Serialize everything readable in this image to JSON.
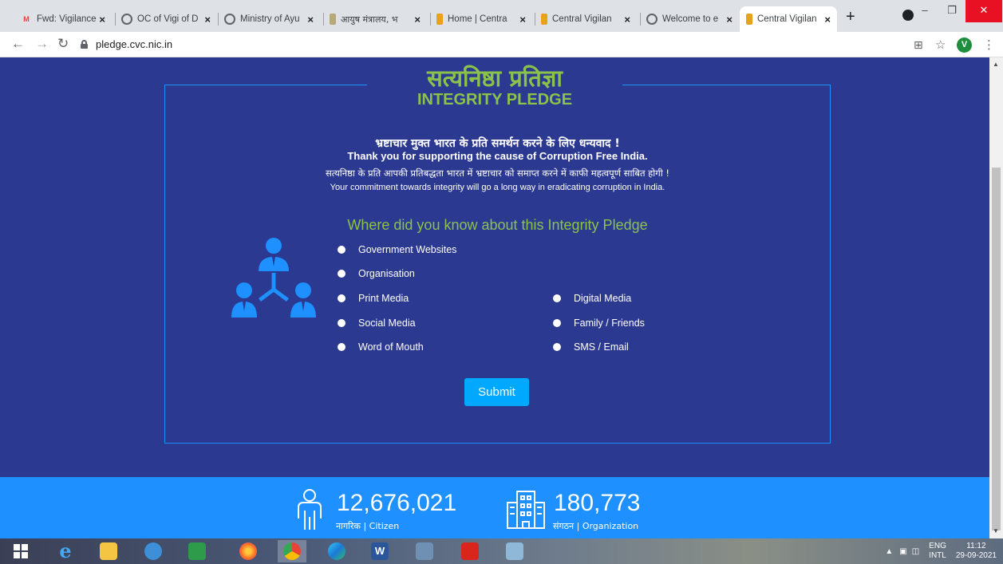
{
  "browser": {
    "tabs": [
      {
        "title": "Fwd: Vigilance",
        "icon": "gmail-icon",
        "color": "#ea4335"
      },
      {
        "title": "OC of Vigi of D",
        "icon": "globe-icon",
        "color": "#5f6368"
      },
      {
        "title": "Ministry of Ayu",
        "icon": "globe-icon",
        "color": "#5f6368"
      },
      {
        "title": "आयुष मंत्रालय, भ",
        "icon": "emblem-icon",
        "color": "#7a6a40"
      },
      {
        "title": "Home | Centra",
        "icon": "cvc-icon",
        "color": "#e8a317"
      },
      {
        "title": "Central Vigilan",
        "icon": "cvc-icon",
        "color": "#e8a317"
      },
      {
        "title": "Welcome to e",
        "icon": "globe-icon",
        "color": "#5f6368"
      },
      {
        "title": "Central Vigilan",
        "icon": "cvc-icon",
        "color": "#e8a317"
      }
    ],
    "close_glyph": "×",
    "new_tab": "+",
    "url": "pledge.cvc.nic.in",
    "profile_initial": "V"
  },
  "page": {
    "title_hi": "सत्यनिष्ठा प्रतिज्ञा",
    "title_en": "INTEGRITY PLEDGE",
    "thanks_hi": "भ्रष्टाचार मुक्त भारत के प्रति समर्थन करने के लिए धन्यवाद !",
    "thanks_en": "Thank you for supporting the cause of Corruption Free India.",
    "commit_hi": "सत्यनिष्ठा के प्रति आपकी प्रतिबद्धता भारत में भ्रष्टाचार को समाप्त करने में काफी महत्वपूर्ण साबित होगी !",
    "commit_en": "Your commitment towards integrity will go a long way in eradicating corruption in India.",
    "question": "Where did you know about this Integrity Pledge",
    "options": {
      "gov_websites": "Government Websites",
      "organisation": "Organisation",
      "print_media": "Print Media",
      "digital_media": "Digital Media",
      "social_media": "Social Media",
      "family_friends": "Family / Friends",
      "word_of_mouth": "Word of Mouth",
      "sms_email": "SMS / Email"
    },
    "submit": "Submit"
  },
  "stats": {
    "citizen_count": "12,676,021",
    "citizen_label": "नागरिक | Citizen",
    "org_count": "180,773",
    "org_label": "संगठन | Organization"
  },
  "taskbar": {
    "lang_top": "ENG",
    "lang_bottom": "INTL",
    "time": "11:12",
    "date": "29-09-2021"
  },
  "colors": {
    "page_bg": "#2b3990",
    "accent_green": "#8bc34a",
    "accent_blue": "#1e90ff",
    "button_blue": "#00a8ff"
  }
}
